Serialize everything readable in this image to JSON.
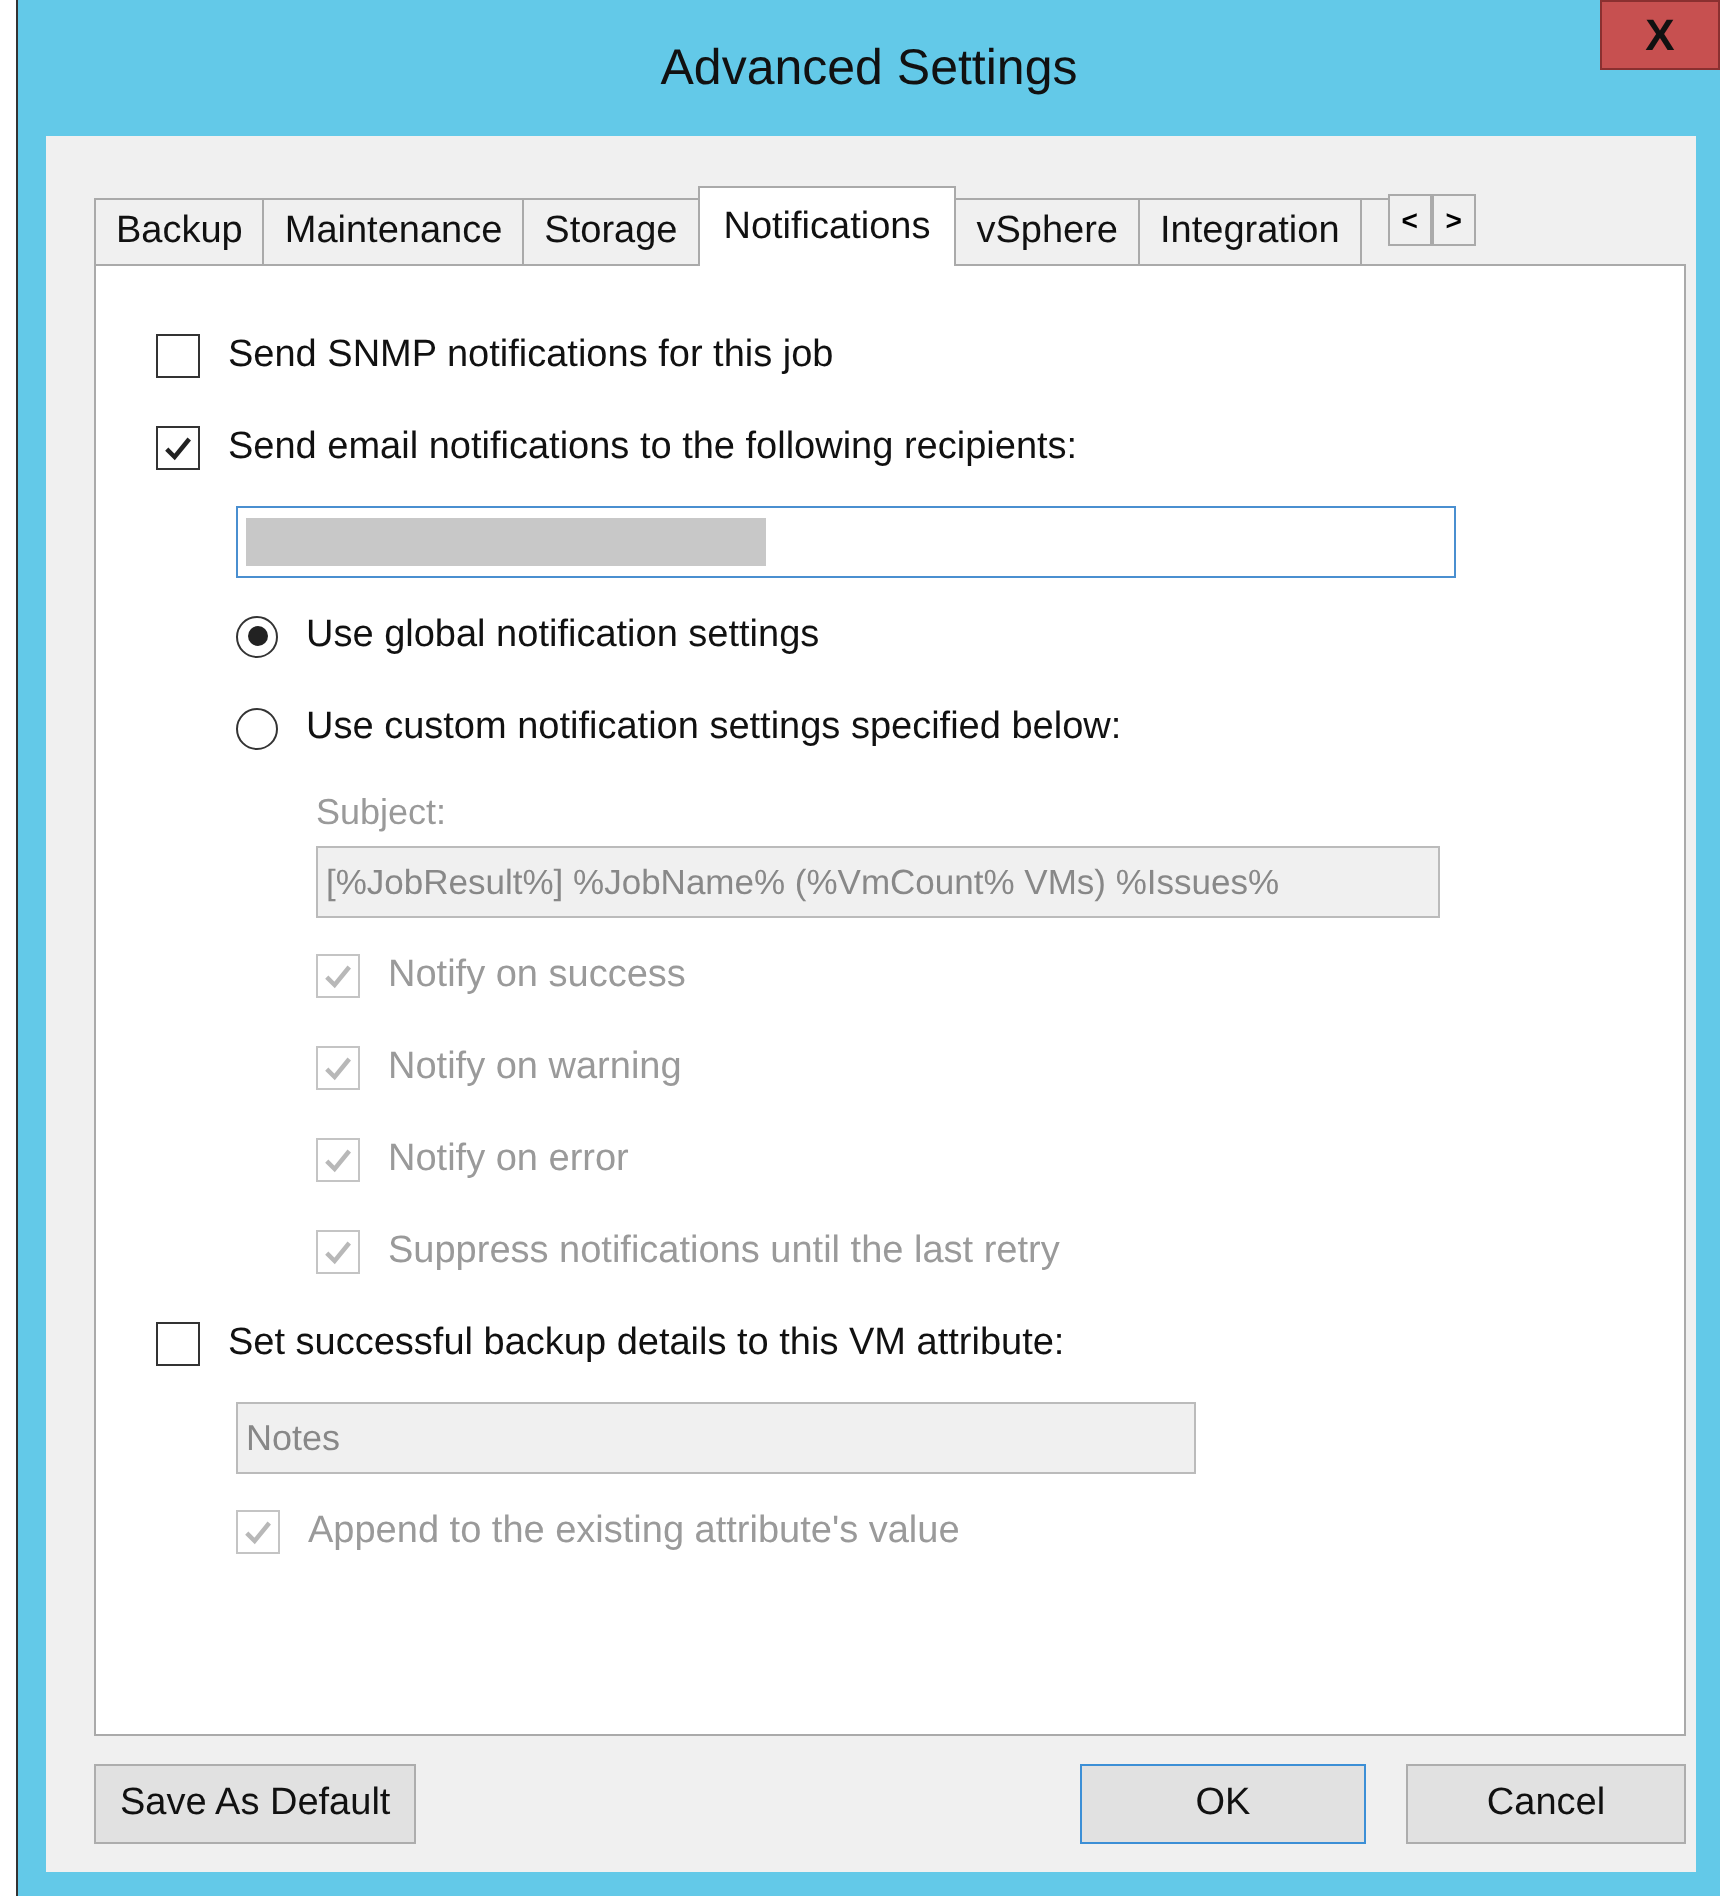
{
  "window": {
    "title": "Advanced Settings",
    "close": "X"
  },
  "tabs": [
    {
      "label": "Backup",
      "selected": false
    },
    {
      "label": "Maintenance",
      "selected": false
    },
    {
      "label": "Storage",
      "selected": false
    },
    {
      "label": "Notifications",
      "selected": true
    },
    {
      "label": "vSphere",
      "selected": false
    },
    {
      "label": "Integration",
      "selected": false
    }
  ],
  "tab_scroll": [
    "<",
    ">"
  ],
  "options": [
    {
      "kind": "checkbox",
      "label": "Send SNMP notifications for this job",
      "checked": false,
      "disabled": false
    },
    {
      "kind": "checkbox",
      "label": "Send email notifications to the following recipients:",
      "checked": true,
      "disabled": false,
      "children": [
        {
          "kind": "field",
          "redacted": true,
          "disabled": false
        },
        {
          "kind": "radio",
          "label": "Use global notification settings",
          "selected": true,
          "disabled": false
        },
        {
          "kind": "radio",
          "label": "Use custom notification settings specified below:",
          "selected": false,
          "disabled": false,
          "children": [
            {
              "kind": "label",
              "label": "Subject:",
              "disabled": true
            },
            {
              "kind": "field",
              "value": "[%JobResult%] %JobName% (%VmCount% VMs) %Issues%",
              "disabled": true,
              "wide": true
            },
            {
              "kind": "checkbox",
              "label": "Notify on success",
              "checked": true,
              "disabled": true
            },
            {
              "kind": "checkbox",
              "label": "Notify on warning",
              "checked": true,
              "disabled": true
            },
            {
              "kind": "checkbox",
              "label": "Notify on error",
              "checked": true,
              "disabled": true
            },
            {
              "kind": "checkbox",
              "label": "Suppress notifications until the last retry",
              "checked": true,
              "disabled": true
            }
          ]
        }
      ]
    },
    {
      "kind": "checkbox",
      "label": "Set successful backup details to this VM attribute:",
      "checked": false,
      "disabled": false,
      "children": [
        {
          "kind": "field",
          "value": "Notes",
          "disabled": true,
          "wide": false
        },
        {
          "kind": "checkbox",
          "label": "Append to the existing attribute's value",
          "checked": true,
          "disabled": true
        }
      ]
    }
  ],
  "buttons": {
    "left": "Save As Default",
    "ok": "OK",
    "cancel": "Cancel"
  }
}
